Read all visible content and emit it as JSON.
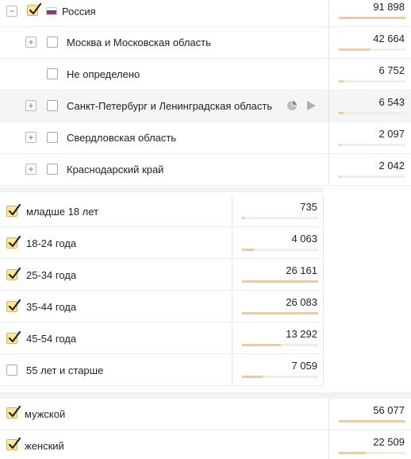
{
  "colors": {
    "bar_fill": "#f6c98c",
    "bar_track": "#f4ede0",
    "checkbox_checked": "#ffe69a",
    "row_hover": "#f5f5f5"
  },
  "regions": {
    "root": {
      "label": "Россия",
      "value": "91 898",
      "fraction": 1.0,
      "checked": true,
      "expanded": true
    },
    "items": [
      {
        "label": "Москва и Московская область",
        "value": "42 664",
        "fraction": 0.46,
        "checked": false,
        "has_expander": true
      },
      {
        "label": "Не определено",
        "value": "6 752",
        "fraction": 0.073,
        "checked": false,
        "has_expander": false
      },
      {
        "label": "Санкт-Петербург и Ленинградская область",
        "value": "6 543",
        "fraction": 0.071,
        "checked": false,
        "has_expander": true,
        "hovered": true
      },
      {
        "label": "Свердловская область",
        "value": "2 097",
        "fraction": 0.023,
        "checked": false,
        "has_expander": true
      },
      {
        "label": "Краснодарский край",
        "value": "2 042",
        "fraction": 0.022,
        "checked": false,
        "has_expander": true
      }
    ]
  },
  "ages": [
    {
      "label": "младше 18 лет",
      "value": "735",
      "fraction": 0.028,
      "checked": true
    },
    {
      "label": "18-24 года",
      "value": "4 063",
      "fraction": 0.155,
      "checked": true
    },
    {
      "label": "25-34 года",
      "value": "26 161",
      "fraction": 1.0,
      "checked": true
    },
    {
      "label": "35-44 года",
      "value": "26 083",
      "fraction": 0.997,
      "checked": true
    },
    {
      "label": "45-54 года",
      "value": "13 292",
      "fraction": 0.508,
      "checked": true
    },
    {
      "label": "55 лет и старше",
      "value": "7 059",
      "fraction": 0.27,
      "checked": false
    }
  ],
  "genders": [
    {
      "label": "мужской",
      "value": "56 077",
      "fraction": 1.0,
      "checked": true
    },
    {
      "label": "женский",
      "value": "22 509",
      "fraction": 0.4,
      "checked": true
    }
  ],
  "icons": {
    "collapse": "minus-icon",
    "expand": "plus-icon",
    "flag": "russia-flag-icon",
    "pie": "pie-chart-icon",
    "play": "play-icon",
    "check": "check-icon"
  }
}
